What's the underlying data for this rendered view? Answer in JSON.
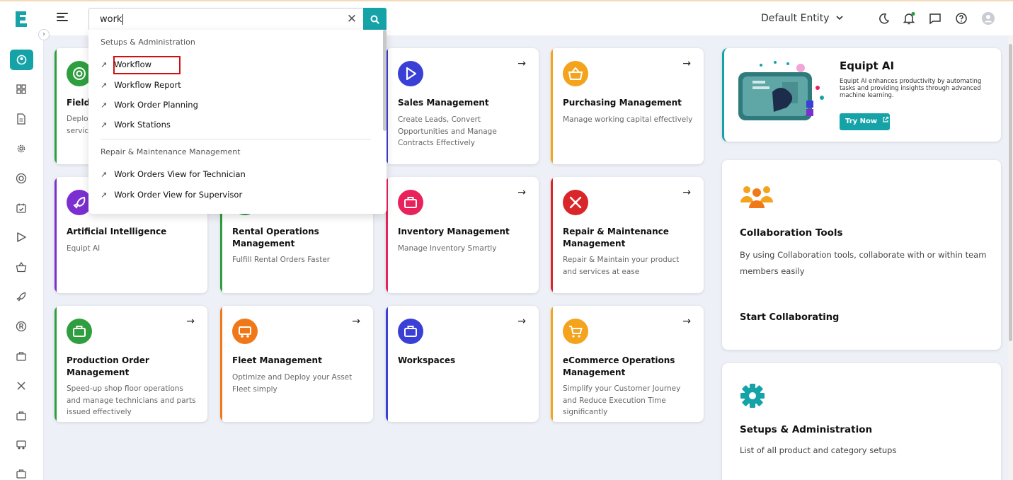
{
  "header": {
    "search": {
      "value": "work",
      "clear_icon": "close-icon",
      "button_icon": "search-icon"
    },
    "entity": "Default Entity",
    "icons": [
      "moon-icon",
      "bell-icon",
      "chat-icon",
      "help-icon",
      "user-avatar-icon"
    ]
  },
  "sidebar": {
    "items": [
      "dashboard-icon",
      "grid-icon",
      "document-icon",
      "gear-icon",
      "target-icon",
      "calendar-icon",
      "play-icon",
      "basket-icon",
      "rocket-icon",
      "registered-icon",
      "briefcase-icon",
      "tools-icon",
      "briefcase-icon",
      "truck-icon",
      "briefcase-icon"
    ]
  },
  "search_dropdown": {
    "sections": [
      {
        "title": "Setups & Administration",
        "items": [
          "Workflow",
          "Workflow Report",
          "Work Order Planning",
          "Work Stations"
        ]
      },
      {
        "title": "Repair & Maintenance Management",
        "items": [
          "Work Orders View for Technician",
          "Work Order View for Supervisor"
        ]
      }
    ],
    "arrow": "↗"
  },
  "cards": [
    {
      "title": "Field",
      "desc": "Deplo servic"
    },
    {
      "title": "Sales Management",
      "desc": "Create Leads, Convert Opportunities and Manage Contracts Effectively"
    },
    {
      "title": "Purchasing Management",
      "desc": "Manage working capital effectively"
    },
    {
      "title": "Artificial Intelligence",
      "desc": "Equipt AI"
    },
    {
      "title": "Rental Operations Management",
      "desc": "Fulfill Rental Orders Faster"
    },
    {
      "title": "Inventory Management",
      "desc": "Manage Inventory Smartly"
    },
    {
      "title": "Repair & Maintenance Management",
      "desc": "Repair & Maintain your product and services at ease"
    },
    {
      "title": "Production Order Management",
      "desc": "Speed-up shop floor operations and manage technicians and parts issued effectively"
    },
    {
      "title": "Fleet Management",
      "desc": "Optimize and Deploy your Asset Fleet simply"
    },
    {
      "title": "Workspaces",
      "desc": ""
    },
    {
      "title": "eCommerce Operations Management",
      "desc": "Simplify your Customer Journey and Reduce Execution Time significantly"
    }
  ],
  "card_arrow": "→",
  "equipt_ai": {
    "title": "Equipt AI",
    "desc": "Equipt AI enhances productivity by automating tasks and providing insights through advanced machine learning.",
    "button": "Try Now"
  },
  "collaboration": {
    "title": "Collaboration Tools",
    "desc": "By using Collaboration tools, collaborate with or within team members easily",
    "link": "Start Collaborating"
  },
  "setups": {
    "title": "Setups & Administration",
    "desc": "List of all product and category setups"
  },
  "colors": {
    "teal": "#16a3a8",
    "green": "#2e9e3e",
    "blue": "#3a3fd6",
    "orange": "#f4a31c",
    "purple": "#7b2fd0",
    "pink": "#e8235c",
    "red": "#d9262b",
    "fleet": "#f07818"
  }
}
